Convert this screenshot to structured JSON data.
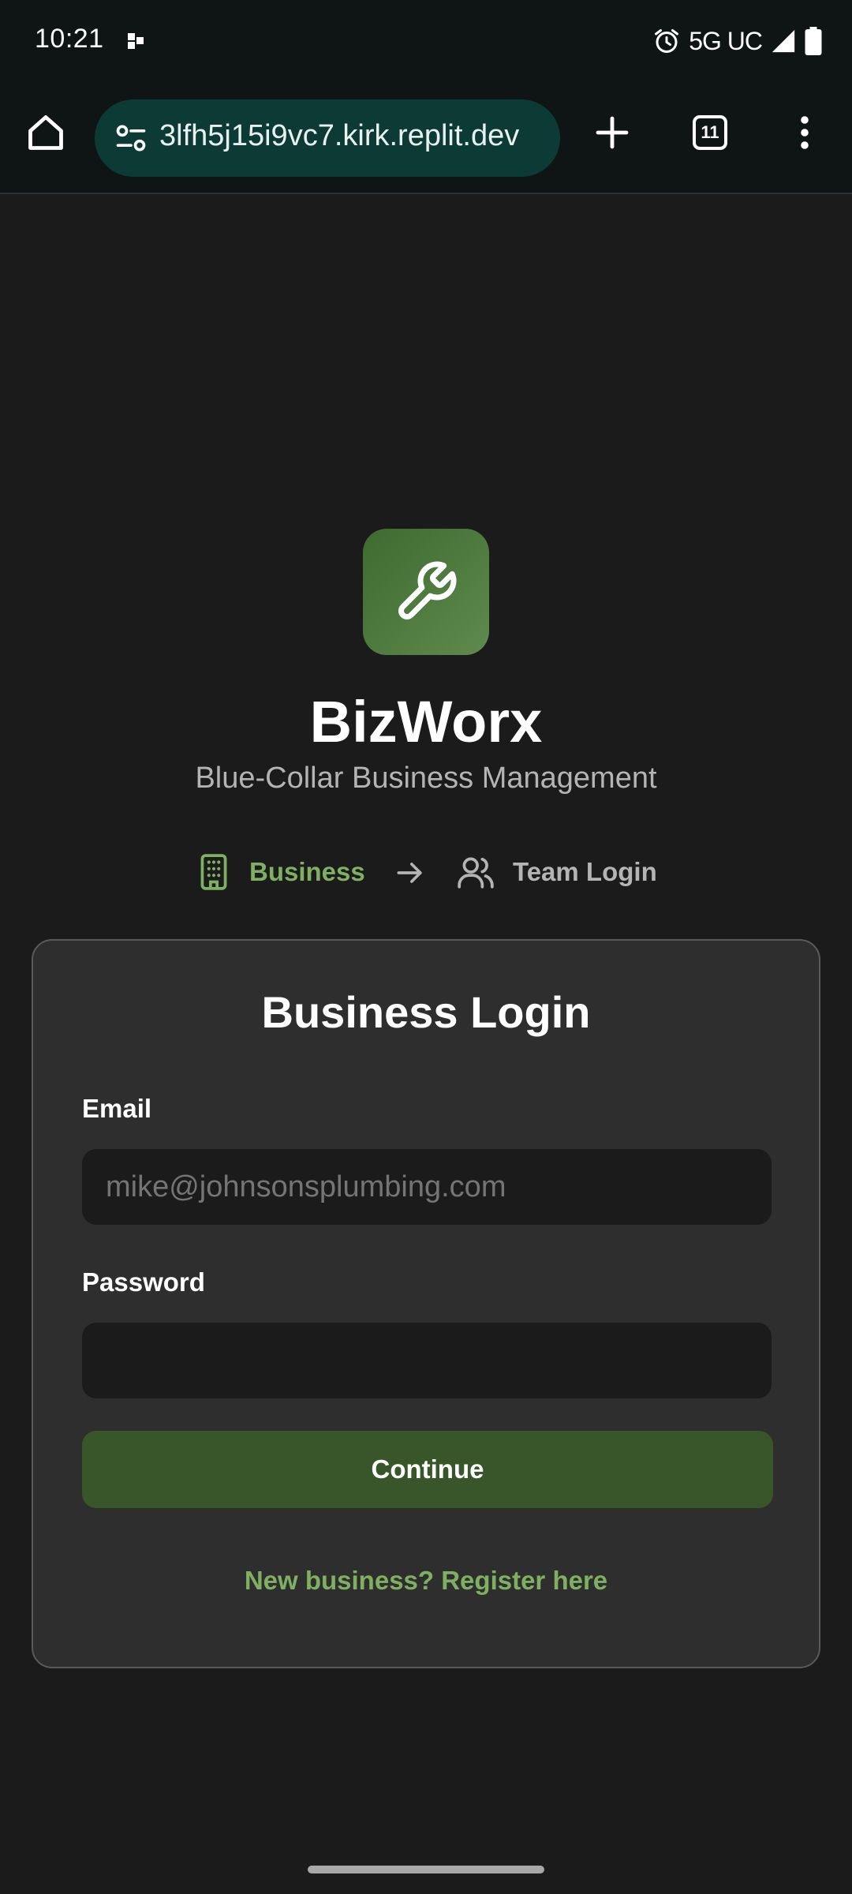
{
  "status_bar": {
    "time": "10:21",
    "network": "5G UC",
    "icons": [
      "notification-dot-icon",
      "alarm-icon",
      "signal-icon",
      "battery-icon"
    ]
  },
  "browser": {
    "url": "3lfh5j15i9vc7.kirk.replit.dev",
    "tab_count": "11",
    "icons": [
      "home-icon",
      "site-settings-icon",
      "new-tab-icon",
      "tabs-icon",
      "menu-icon"
    ]
  },
  "app": {
    "logo_icon": "wrench-icon",
    "title": "BizWorx",
    "subtitle": "Blue-Collar Business Management"
  },
  "steps": [
    {
      "label": "Business",
      "icon": "building-icon",
      "active": true
    },
    {
      "label": "Team Login",
      "icon": "users-icon",
      "active": false
    }
  ],
  "login_card": {
    "title": "Business Login",
    "email_label": "Email",
    "email_placeholder": "mike@johnsonsplumbing.com",
    "email_value": "",
    "password_label": "Password",
    "password_value": "",
    "continue_label": "Continue",
    "register_link": "New business? Register here"
  },
  "colors": {
    "background": "#1b1b1b",
    "card": "#2e2e2f",
    "accent_green": "#7fb062",
    "button_green": "#38562a",
    "url_pill": "#0c3b36"
  }
}
